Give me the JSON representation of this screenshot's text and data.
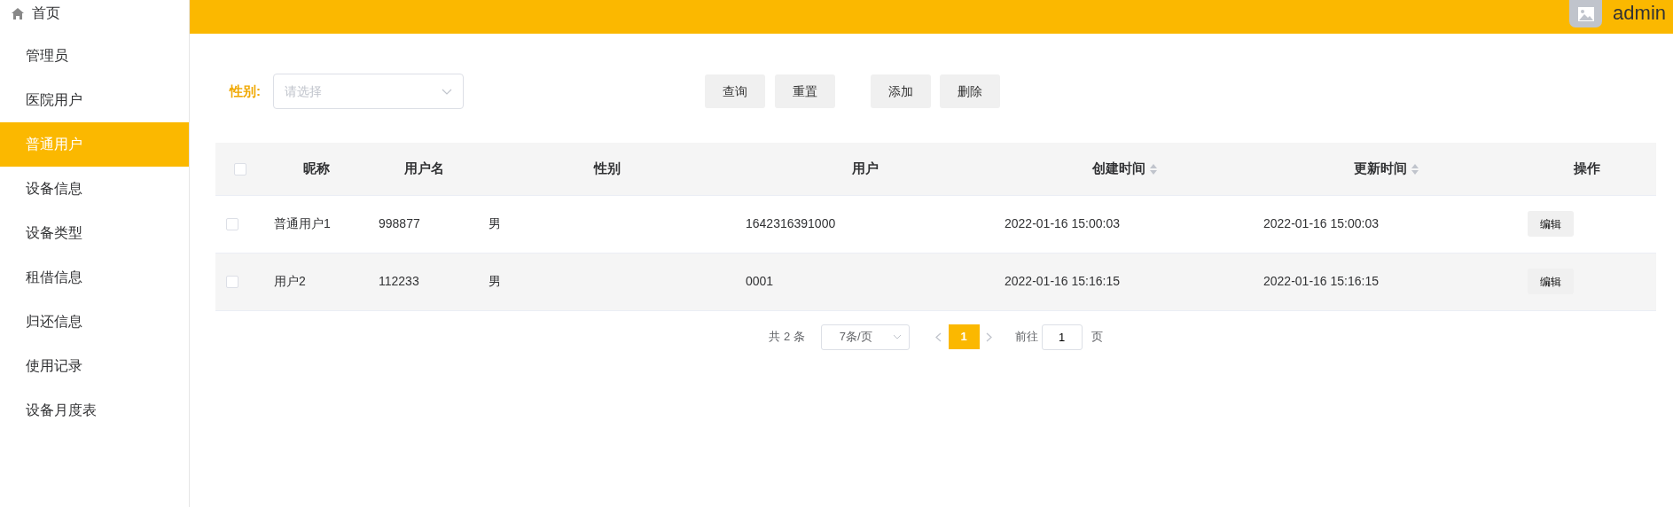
{
  "sidebar": {
    "home": {
      "label": "首页"
    },
    "items": [
      {
        "label": "管理员",
        "selected": false
      },
      {
        "label": "医院用户",
        "selected": false
      },
      {
        "label": "普通用户",
        "selected": true
      },
      {
        "label": "设备信息",
        "selected": false
      },
      {
        "label": "设备类型",
        "selected": false
      },
      {
        "label": "租借信息",
        "selected": false
      },
      {
        "label": "归还信息",
        "selected": false
      },
      {
        "label": "使用记录",
        "selected": false
      },
      {
        "label": "设备月度表",
        "selected": false
      }
    ]
  },
  "header": {
    "user": "admin"
  },
  "filter": {
    "label": "性别:",
    "placeholder": "请选择"
  },
  "buttons": [
    {
      "label": "查询"
    },
    {
      "label": "重置"
    },
    {
      "label": "添加"
    },
    {
      "label": "删除"
    }
  ],
  "table": {
    "all_checked": false,
    "columns": [
      {
        "label": "昵称",
        "sortable": false
      },
      {
        "label": "用户名",
        "sortable": false
      },
      {
        "label": "性别",
        "sortable": false
      },
      {
        "label": "用户",
        "sortable": false
      },
      {
        "label": "创建时间",
        "sortable": true
      },
      {
        "label": "更新时间",
        "sortable": true
      },
      {
        "label": "操作",
        "sortable": false
      }
    ],
    "rows": [
      {
        "checked": false,
        "cells": [
          "普通用户1",
          "998877",
          "男",
          "1642316391000",
          "2022-01-16 15:00:03",
          "2022-01-16 15:00:03"
        ],
        "action": "编辑"
      },
      {
        "checked": false,
        "cells": [
          "用户2",
          "112233",
          "男",
          "0001",
          "2022-01-16 15:16:15",
          "2022-01-16 15:16:15"
        ],
        "action": "编辑"
      }
    ]
  },
  "pagination": {
    "total": "共 2 条",
    "page_size": "7条/页",
    "pages": [
      {
        "label": "1",
        "selected": true
      }
    ],
    "goto_label": "前往",
    "goto_value": "1",
    "goto_suffix": "页"
  }
}
